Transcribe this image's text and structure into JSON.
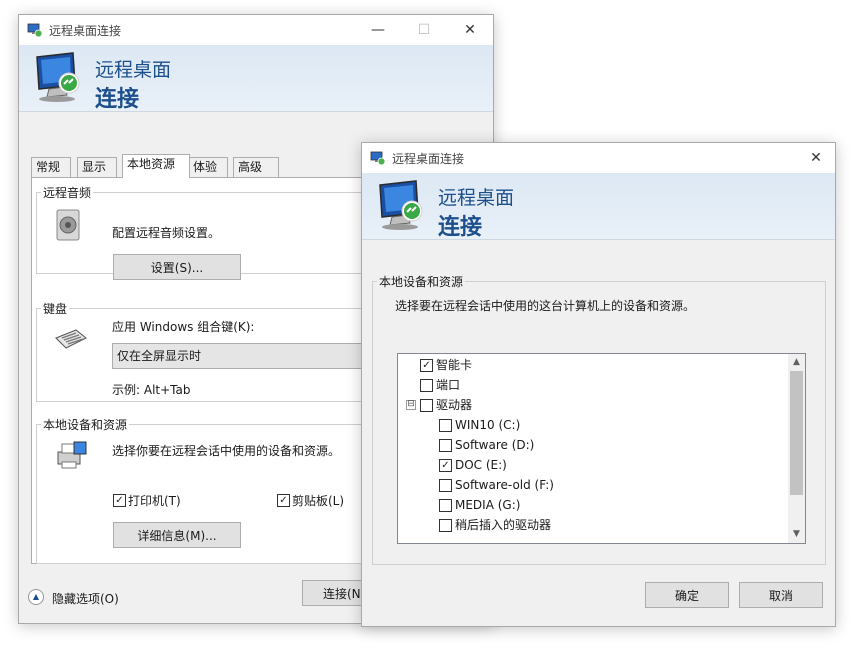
{
  "main_window": {
    "title": "远程桌面连接",
    "banner_line1": "远程桌面",
    "banner_line2": "连接",
    "tabs": [
      {
        "label": "常规"
      },
      {
        "label": "显示"
      },
      {
        "label": "本地资源",
        "active": true
      },
      {
        "label": "体验"
      },
      {
        "label": "高级"
      }
    ],
    "audio": {
      "legend": "远程音频",
      "description": "配置远程音频设置。",
      "settings_button": "设置(S)..."
    },
    "keyboard": {
      "legend": "键盘",
      "label": "应用 Windows 组合键(K):",
      "selected_option": "仅在全屏显示时",
      "example": "示例: Alt+Tab"
    },
    "local_devices": {
      "legend": "本地设备和资源",
      "description": "选择你要在远程会话中使用的设备和资源。",
      "printers": {
        "label": "打印机(T)",
        "checked": true
      },
      "clipboard": {
        "label": "剪贴板(L)",
        "checked": true
      },
      "details_button": "详细信息(M)..."
    },
    "hide_options": "隐藏选项(O)",
    "connect_button": "连接(N"
  },
  "dialog": {
    "title": "远程桌面连接",
    "banner_line1": "远程桌面",
    "banner_line2": "连接",
    "group_legend": "本地设备和资源",
    "instruction": "选择要在远程会话中使用的这台计算机上的设备和资源。",
    "items": [
      {
        "label": "智能卡",
        "checked": true,
        "level": 0
      },
      {
        "label": "端口",
        "checked": false,
        "level": 0
      },
      {
        "label": "驱动器",
        "checked": false,
        "level": 0,
        "expander": "⊟"
      },
      {
        "label": "WIN10 (C:)",
        "checked": false,
        "level": 1
      },
      {
        "label": "Software (D:)",
        "checked": false,
        "level": 1
      },
      {
        "label": "DOC (E:)",
        "checked": true,
        "level": 1
      },
      {
        "label": "Software-old (F:)",
        "checked": false,
        "level": 1
      },
      {
        "label": "MEDIA (G:)",
        "checked": false,
        "level": 1
      },
      {
        "label": "稍后插入的驱动器",
        "checked": false,
        "level": 1
      }
    ],
    "ok_button": "确定",
    "cancel_button": "取消"
  },
  "icons": {
    "minimize": "minimize-icon",
    "maximize": "maximize-icon",
    "close": "close-icon",
    "hide": "chevron-up-icon"
  },
  "colors": {
    "banner_text": "#1c4f8b",
    "banner_bg": "#dce8f4",
    "window_bg": "#f0f0f0"
  }
}
